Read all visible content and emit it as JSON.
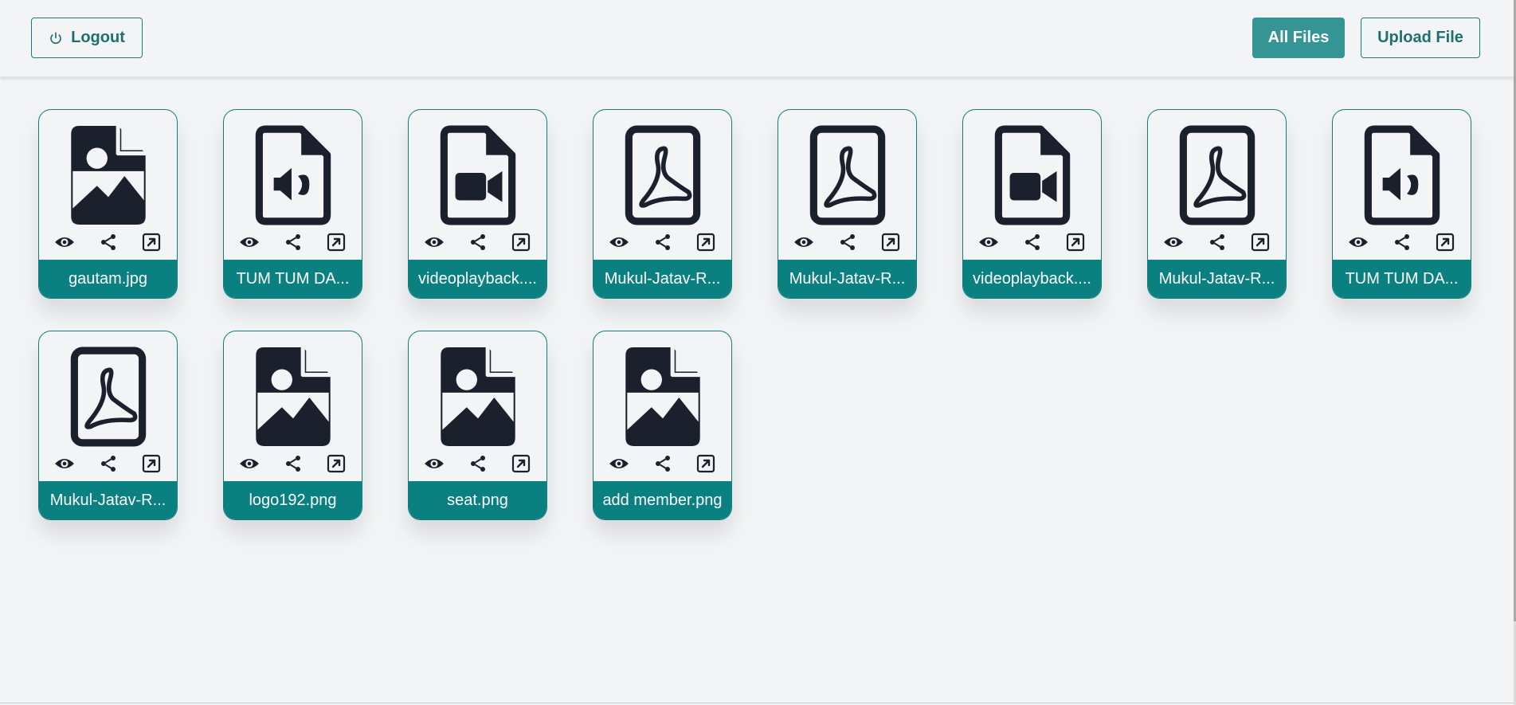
{
  "header": {
    "logout_label": "Logout",
    "all_files_label": "All Files",
    "upload_label": "Upload File"
  },
  "colors": {
    "accent": "#0a8080",
    "accent_button": "#359595",
    "icon": "#1a202c",
    "background": "#f3f4f6"
  },
  "files": [
    {
      "name": "gautam.jpg",
      "icon": "image-file-icon"
    },
    {
      "name": "TUM TUM DA...",
      "icon": "audio-file-icon"
    },
    {
      "name": "videoplayback....",
      "icon": "video-file-icon"
    },
    {
      "name": "Mukul-Jatav-R...",
      "icon": "pdf-file-icon"
    },
    {
      "name": "Mukul-Jatav-R...",
      "icon": "pdf-file-icon"
    },
    {
      "name": "videoplayback....",
      "icon": "video-file-icon"
    },
    {
      "name": "Mukul-Jatav-R...",
      "icon": "pdf-file-icon"
    },
    {
      "name": "TUM TUM DA...",
      "icon": "audio-file-icon"
    },
    {
      "name": "Mukul-Jatav-R...",
      "icon": "pdf-file-icon"
    },
    {
      "name": "logo192.png",
      "icon": "image-file-icon"
    },
    {
      "name": "seat.png",
      "icon": "image-file-icon"
    },
    {
      "name": "add member.png",
      "icon": "image-file-icon"
    }
  ],
  "card_actions": [
    "view-icon",
    "share-icon",
    "open-external-icon"
  ]
}
